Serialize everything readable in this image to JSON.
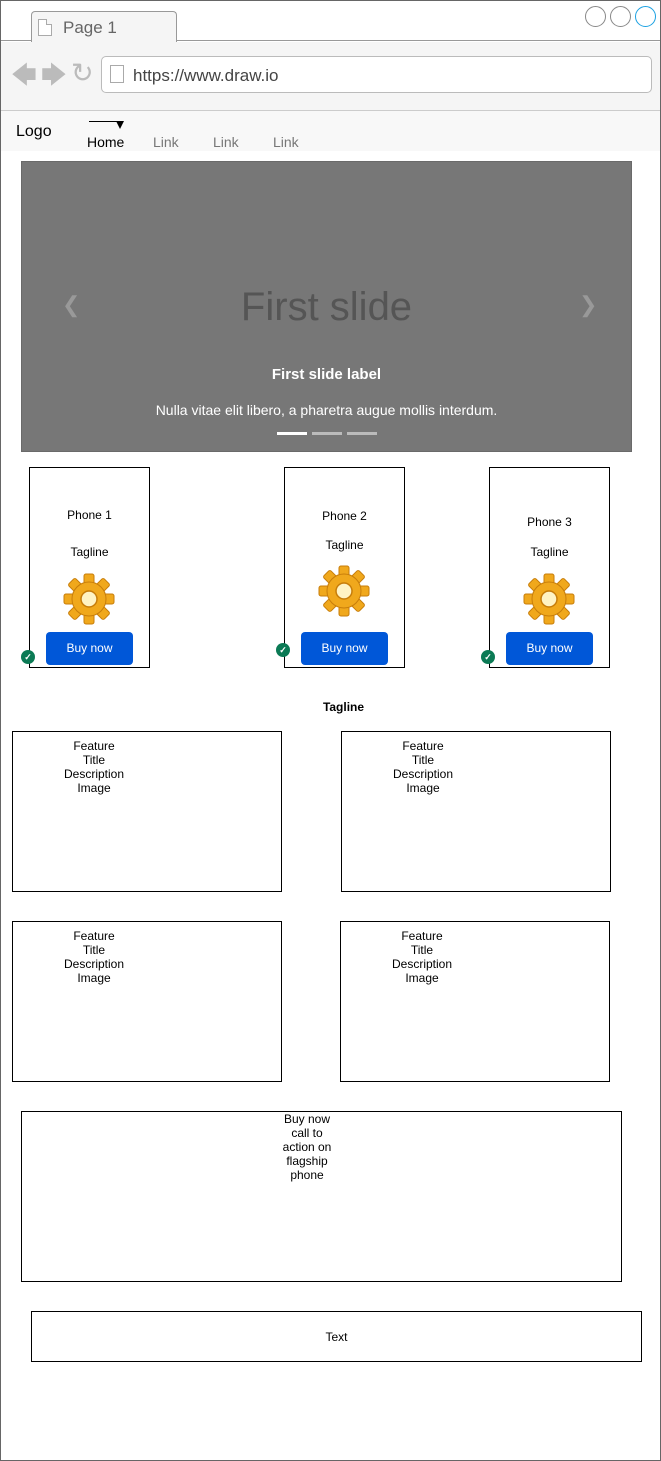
{
  "browser": {
    "tab_title": "Page 1",
    "url": "https://www.draw.io",
    "window_buttons": [
      "circle",
      "circle",
      "circle"
    ]
  },
  "navbar": {
    "logo": "Logo",
    "links": [
      "Home",
      "Link",
      "Link",
      "Link"
    ],
    "active_index": 0
  },
  "carousel": {
    "slide_title": "First slide",
    "label": "First slide label",
    "caption": "Nulla vitae elit libero, a pharetra augue mollis interdum.",
    "prev_icon": "chevron-left-icon",
    "next_icon": "chevron-right-icon",
    "indicator_count": 3,
    "active_indicator": 0,
    "background_color": "#777777"
  },
  "products": [
    {
      "name": "Phone 1",
      "tagline": "Tagline",
      "button": "Buy now",
      "icon": "gear-icon"
    },
    {
      "name": "Phone 2",
      "tagline": "Tagline",
      "button": "Buy now",
      "icon": "gear-icon"
    },
    {
      "name": "Phone 3",
      "tagline": "Tagline",
      "button": "Buy now",
      "icon": "gear-icon"
    }
  ],
  "tagline": "Tagline",
  "features": [
    {
      "lines": [
        "Feature",
        "Title",
        "Description",
        "Image"
      ]
    },
    {
      "lines": [
        "Feature",
        "Title",
        "Description",
        "Image"
      ]
    },
    {
      "lines": [
        "Feature",
        "Title",
        "Description",
        "Image"
      ]
    },
    {
      "lines": [
        "Feature",
        "Title",
        "Description",
        "Image"
      ]
    }
  ],
  "cta": {
    "lines": [
      "Buy now",
      "call to",
      "action on",
      "flagship",
      "phone"
    ]
  },
  "text_box": "Text",
  "colors": {
    "button": "#0057d8",
    "check": "#0b7a55",
    "accent": "#1ba1e2"
  }
}
